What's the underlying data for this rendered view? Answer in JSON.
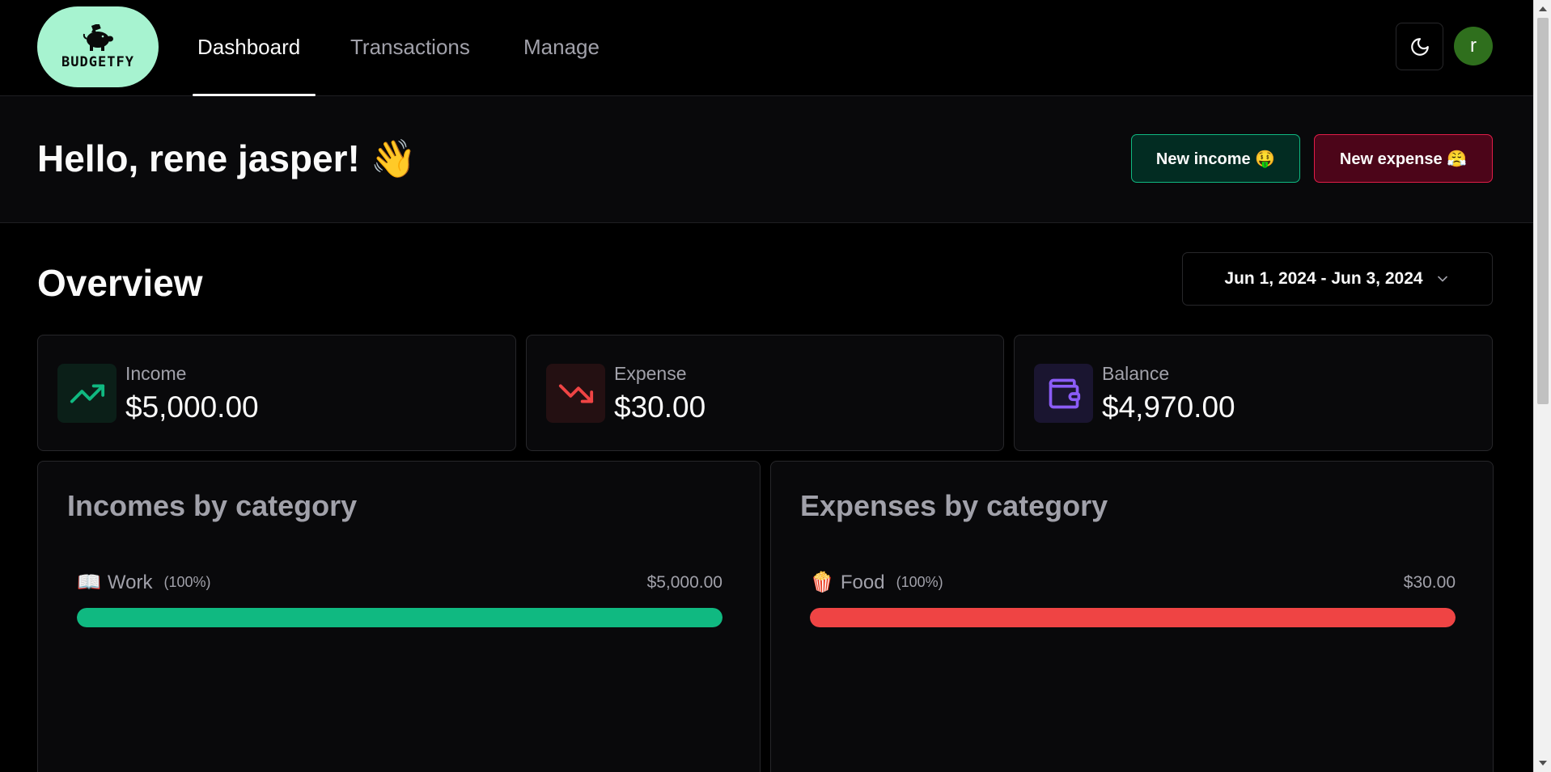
{
  "nav": {
    "logo_text": "BUDGETFY",
    "links": [
      {
        "label": "Dashboard",
        "active": true
      },
      {
        "label": "Transactions",
        "active": false
      },
      {
        "label": "Manage",
        "active": false
      }
    ],
    "avatar_initial": "r",
    "theme_icon": "moon-icon"
  },
  "greeting": {
    "text": "Hello, rene jasper! 👋",
    "new_income_label": "New income 🤑",
    "new_expense_label": "New expense 😤"
  },
  "overview": {
    "title": "Overview",
    "date_range": "Jun 1, 2024 - Jun 3, 2024",
    "stats": [
      {
        "label": "Income",
        "value": "$5,000.00",
        "icon": "trending-up-icon",
        "color": "#10b981"
      },
      {
        "label": "Expense",
        "value": "$30.00",
        "icon": "trending-down-icon",
        "color": "#ef4444"
      },
      {
        "label": "Balance",
        "value": "$4,970.00",
        "icon": "wallet-icon",
        "color": "#8b5cf6"
      }
    ]
  },
  "incomes_by_category": {
    "title": "Incomes by category",
    "items": [
      {
        "icon": "📖",
        "name": "Work",
        "percent_label": "(100%)",
        "amount": "$5,000.00",
        "percent": 100,
        "color": "#10b981"
      }
    ]
  },
  "expenses_by_category": {
    "title": "Expenses by category",
    "items": [
      {
        "icon": "🍿",
        "name": "Food",
        "percent_label": "(100%)",
        "amount": "$30.00",
        "percent": 100,
        "color": "#ef4444"
      }
    ]
  }
}
